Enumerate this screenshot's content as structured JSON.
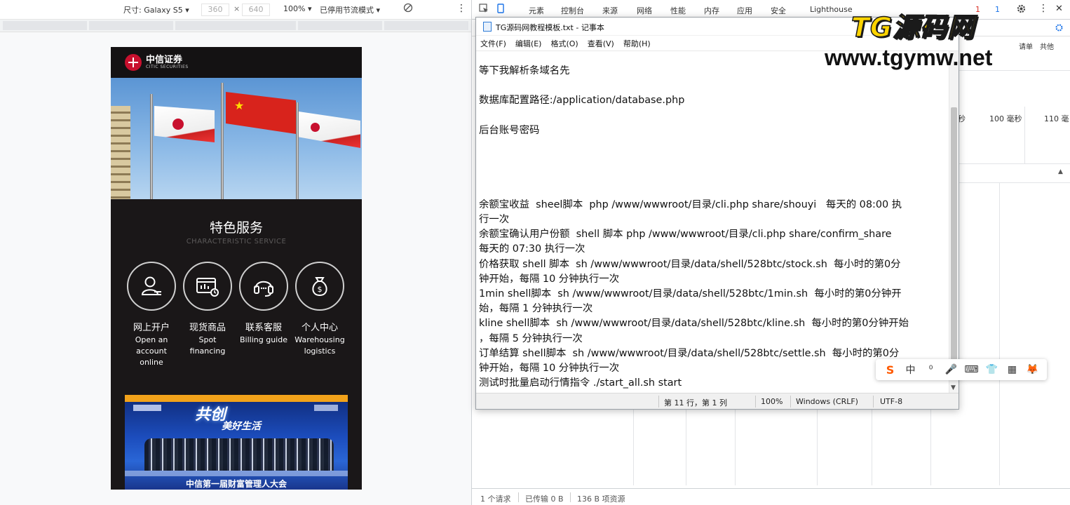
{
  "device_toolbar": {
    "size_label": "尺寸: Galaxy S5 ▾",
    "width": "360",
    "times": "×",
    "height": "640",
    "zoom": "100% ▾",
    "throttle": "已停用节流模式 ▾",
    "more": "⋮"
  },
  "phone": {
    "logo_cn": "中信证券",
    "logo_en": "CITIC SECURITIES",
    "section_title": "特色服务",
    "section_subtitle": "CHARACTERISTIC SERVICE",
    "services": [
      {
        "cn": "网上开户",
        "en": "Open an\naccount\nonline",
        "icon": "user-account-icon"
      },
      {
        "cn": "现货商品",
        "en": "Spot\nfinancing",
        "icon": "financing-chart-icon"
      },
      {
        "cn": "联系客服",
        "en": "Billing guide",
        "icon": "headset-icon"
      },
      {
        "cn": "个人中心",
        "en": "Warehousing\nlogistics",
        "icon": "money-bag-icon"
      }
    ],
    "banner_slogan": "共创",
    "banner_slogan2": "美好生活",
    "banner_caption": "中信第一届财富管理人大会"
  },
  "devtools": {
    "tabs": [
      "元素",
      "控制台",
      "来源",
      "网络",
      "性能",
      "内存",
      "应用",
      "安全",
      "Lighthouse"
    ],
    "sub_labels": [
      "请单",
      "共他"
    ],
    "timings": [
      "秒",
      "100 毫秒",
      "110 毫"
    ],
    "status": [
      "1 个请求",
      "已传输 0 B",
      "136 B 项资源"
    ],
    "badge1": "1",
    "badge2": "1"
  },
  "notepad": {
    "title": "TG源码网教程模板.txt - 记事本",
    "menu": [
      "文件(F)",
      "编辑(E)",
      "格式(O)",
      "查看(V)",
      "帮助(H)"
    ],
    "lines": [
      "等下我解析条域名先",
      "",
      "数据库配置路径:/application/database.php",
      "",
      "后台账号密码",
      "",
      "",
      "",
      "",
      "余额宝收益  sheel脚本  php /www/wwwroot/目录/cli.php share/shouyi   每天的 08:00 执",
      "行一次",
      "余额宝确认用户份额  shell 脚本 php /www/wwwroot/目录/cli.php share/confirm_share",
      "每天的 07:30 执行一次",
      "价格获取 shell 脚本  sh /www/wwwroot/目录/data/shell/528btc/stock.sh  每小时的第0分",
      "钟开始，每隔 10 分钟执行一次",
      "1min shell脚本  sh /www/wwwroot/目录/data/shell/528btc/1min.sh  每小时的第0分钟开",
      "始，每隔 1 分钟执行一次",
      "kline shell脚本  sh /www/wwwroot/目录/data/shell/528btc/kline.sh  每小时的第0分钟开始",
      "，每隔 5 分钟执行一次",
      "订单结算 shell脚本  sh /www/wwwroot/目录/data/shell/528btc/settle.sh  每小时的第0分",
      "钟开始，每隔 10 分钟执行一次",
      "测试时批量启动行情指令 ./start_all.sh start"
    ],
    "status_position": "第 11 行，第 1 列",
    "status_zoom": "100%",
    "status_eol": "Windows (CRLF)",
    "status_encoding": "UTF-8"
  },
  "watermark": {
    "cn": "TG源码网",
    "url": "www.tgymw.net"
  },
  "ime": [
    "中",
    "⁰",
    "🎤",
    "⌨",
    "👕",
    "▦",
    "🦊"
  ]
}
